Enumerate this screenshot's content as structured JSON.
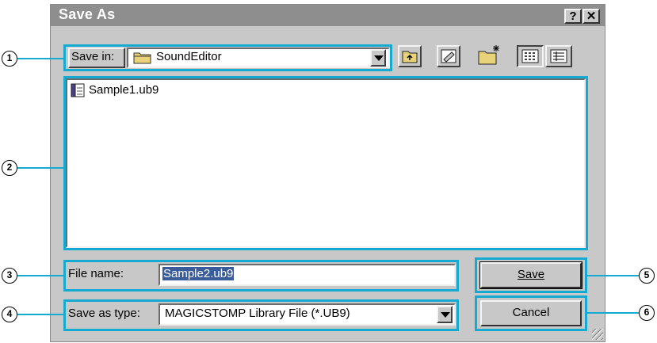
{
  "window": {
    "title": "Save As",
    "help_label": "?",
    "close_label": "✕"
  },
  "toolbar": {
    "save_in_label": "Save in:",
    "save_in_value": "SoundEditor",
    "icons": [
      "up-folder-icon",
      "desktop-icon",
      "new-folder-icon",
      "list-view-icon",
      "details-view-icon"
    ]
  },
  "files": [
    {
      "name": "Sample1.ub9",
      "icon": "library-file-icon"
    }
  ],
  "filename": {
    "label": "File name:",
    "value": "Sample2.ub9"
  },
  "filetype": {
    "label": "Save as type:",
    "value": "MAGICSTOMP Library File (*.UB9)"
  },
  "buttons": {
    "save": "Save",
    "cancel": "Cancel"
  },
  "callouts": [
    "1",
    "2",
    "3",
    "4",
    "5",
    "6"
  ],
  "colors": {
    "callout": "#14aad2",
    "titlebar": "#8e8e8e",
    "face": "#c8c8c8",
    "selection": "#3a5c9a"
  }
}
